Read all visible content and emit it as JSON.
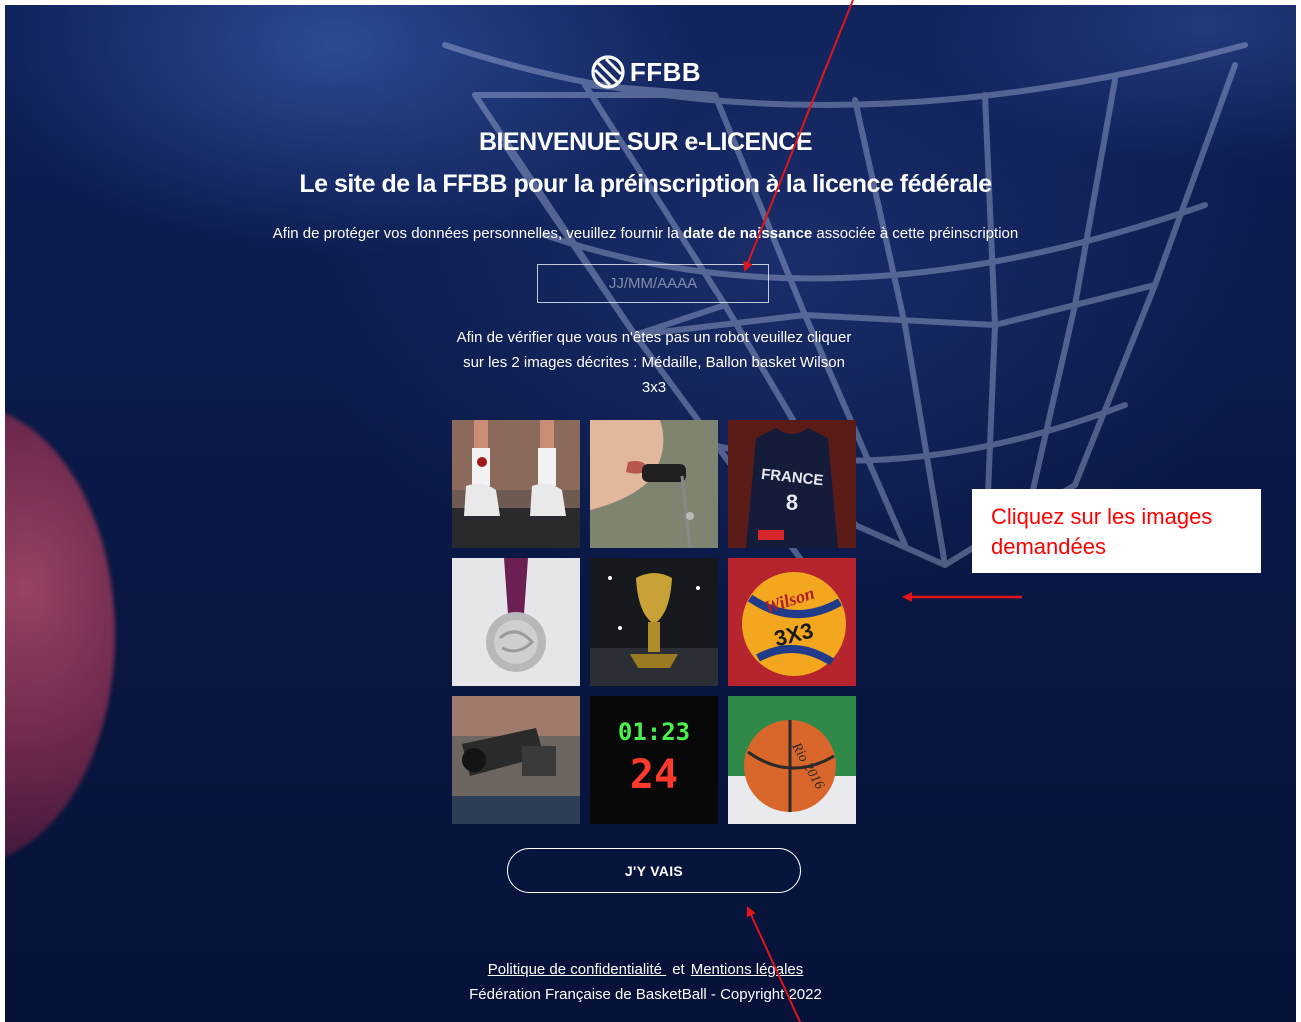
{
  "logo": {
    "text": "FFBB"
  },
  "header": {
    "title_line1": "BIENVENUE SUR e-LICENCE",
    "title_line2": "Le site de la FFBB pour la préinscription à la licence fédérale"
  },
  "intro": {
    "before": "Afin de protéger vos données personnelles, veuillez fournir la ",
    "bold": "date de naissance",
    "after": " associée à cette préinscription"
  },
  "dob_input": {
    "placeholder": "JJ/MM/AAAA",
    "value": ""
  },
  "captcha": {
    "instruction": "Afin de vérifier que vous n'êtes pas un robot veuillez cliquer sur les 2 images décrites : Médaille, Ballon basket Wilson 3x3",
    "images": [
      {
        "subject": "sneakers-feet"
      },
      {
        "subject": "referee-whistle"
      },
      {
        "subject": "france-jersey",
        "printed_text": "FRANCE 8"
      },
      {
        "subject": "medal"
      },
      {
        "subject": "trophy"
      },
      {
        "subject": "wilson-3x3-ball",
        "printed_text": "Wilson 3X3"
      },
      {
        "subject": "tv-camera"
      },
      {
        "subject": "shot-clock",
        "printed_text": "01:23 24"
      },
      {
        "subject": "rio-2016-ball",
        "printed_text": "Rio 2016"
      }
    ]
  },
  "submit": {
    "label": "J'Y VAIS"
  },
  "footer": {
    "privacy_link": "Politique de confidentialité ",
    "separator": "et",
    "legal_link": "Mentions légales",
    "copyright": "Fédération Française de BasketBall - Copyright 2022"
  },
  "annotation": {
    "callout": "Cliquez sur les images demandées"
  },
  "colors": {
    "background": "#0a1a4a",
    "annotation": "#ff0000",
    "text": "#ffffff"
  }
}
